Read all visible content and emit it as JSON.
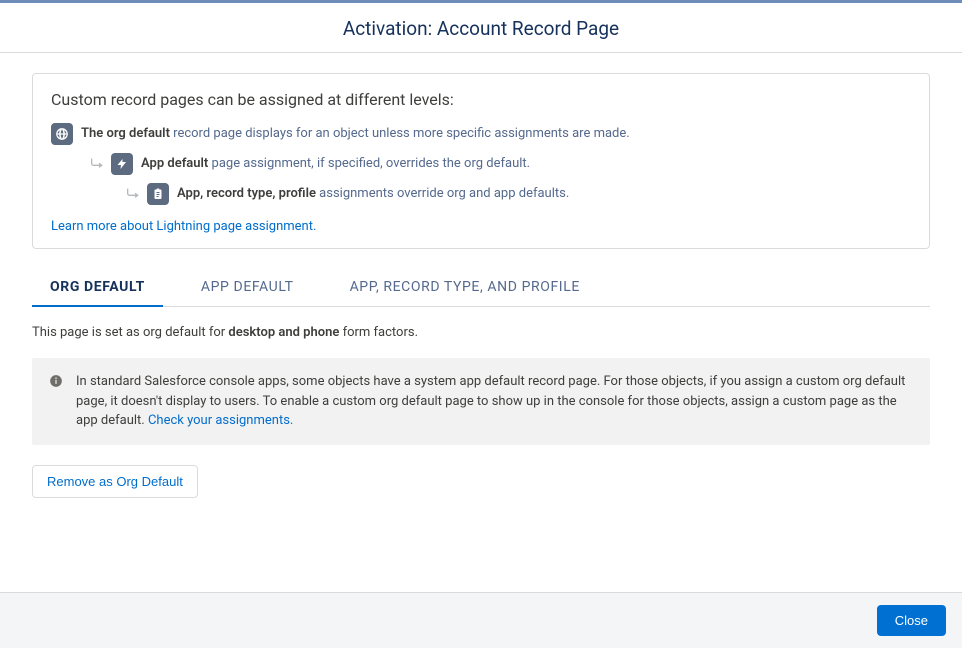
{
  "header": {
    "title": "Activation: Account Record Page"
  },
  "info_card": {
    "title": "Custom record pages can be assigned at different levels:",
    "levels": {
      "org": {
        "bold": "The org default",
        "rest": " record page displays for an object unless more specific assignments are made."
      },
      "app": {
        "bold": "App default",
        "rest": " page assignment, if specified, overrides the org default."
      },
      "art": {
        "bold": "App, record type, profile",
        "rest": " assignments override org and app defaults."
      }
    },
    "learn_more": "Learn more about Lightning page assignment."
  },
  "tabs": {
    "org": "ORG DEFAULT",
    "app": "APP DEFAULT",
    "art": "APP, RECORD TYPE, AND PROFILE"
  },
  "status": {
    "prefix": "This page is set as org default for ",
    "bold": "desktop and phone",
    "suffix": " form factors."
  },
  "notice": {
    "text": "In standard Salesforce console apps, some objects have a system app default record page. For those objects, if you assign a custom org default page, it doesn't display to users. To enable a custom org default page to show up in the console for those objects, assign a custom page as the app default.  ",
    "link": "Check your assignments."
  },
  "actions": {
    "remove": "Remove as Org Default"
  },
  "footer": {
    "close": "Close"
  }
}
